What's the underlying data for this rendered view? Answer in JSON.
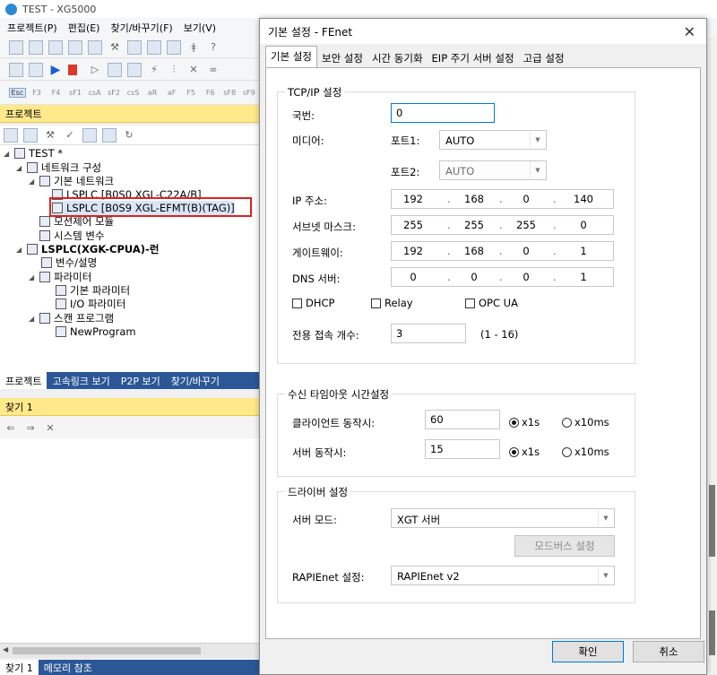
{
  "main": {
    "title": "TEST - XG5000",
    "menu": [
      "프로젝트(P)",
      "편집(E)",
      "찾기/바꾸기(F)",
      "보기(V)"
    ],
    "fkeys": [
      "Esc",
      "F3",
      "F4",
      "sF1",
      "csA",
      "sF2",
      "csS",
      "aR",
      "aF",
      "F5",
      "F6",
      "sF8",
      "sF9"
    ]
  },
  "project_pane": {
    "title": "프로젝트",
    "tree": [
      "TEST *",
      "네트워크 구성",
      "기본 네트워크",
      "LSPLC [B0S0 XGL-C22A/B]",
      "LSPLC [B0S9 XGL-EFMT(B)(TAG)]",
      "모션제어 모듈",
      "시스템 변수",
      "LSPLC(XGK-CPUA)-런",
      "변수/설명",
      "파라미터",
      "기본 파라미터",
      "I/O 파라미터",
      "스캔 프로그램",
      "NewProgram"
    ],
    "tabs": [
      "프로젝트",
      "고속링크 보기",
      "P2P 보기",
      "찾기/바꾸기"
    ]
  },
  "find_pane": {
    "title": "찾기 1"
  },
  "bottom_tabs": [
    "찾기 1",
    "메모리 참조"
  ],
  "dialog": {
    "title": "기본 설정 - FEnet",
    "tabs": [
      "기본 설정",
      "보안 설정",
      "시간 동기화",
      "EIP 주기 서버 설정",
      "고급 설정"
    ],
    "tcpip": {
      "group_title": "TCP/IP 설정",
      "station_label": "국번:",
      "station_value": "0",
      "media_label": "미디어:",
      "port1_label": "포트1:",
      "port1_value": "AUTO",
      "port2_label": "포트2:",
      "port2_value": "AUTO",
      "ip_label": "IP 주소:",
      "ip": [
        "192",
        "168",
        "0",
        "140"
      ],
      "subnet_label": "서브넷 마스크:",
      "subnet": [
        "255",
        "255",
        "255",
        "0"
      ],
      "gateway_label": "게이트웨이:",
      "gateway": [
        "192",
        "168",
        "0",
        "1"
      ],
      "dns_label": "DNS 서버:",
      "dns": [
        "0",
        "0",
        "0",
        "1"
      ],
      "dhcp": "DHCP",
      "relay": "Relay",
      "opcua": "OPC UA",
      "conn_label": "전용 접속 개수:",
      "conn_value": "3",
      "conn_range": "(1 - 16)"
    },
    "timeout": {
      "group_title": "수신 타임아웃 시간설정",
      "client_label": "클라이언트 동작시:",
      "client_value": "60",
      "server_label": "서버 동작시:",
      "server_value": "15",
      "x1s": "x1s",
      "x10ms": "x10ms"
    },
    "driver": {
      "group_title": "드라이버 설정",
      "server_mode_label": "서버 모드:",
      "server_mode_value": "XGT 서버",
      "modbus_button": "모드버스 설정",
      "rapienet_label": "RAPIEnet 설정:",
      "rapienet_value": "RAPIEnet v2"
    },
    "ok": "확인",
    "cancel": "취소"
  }
}
